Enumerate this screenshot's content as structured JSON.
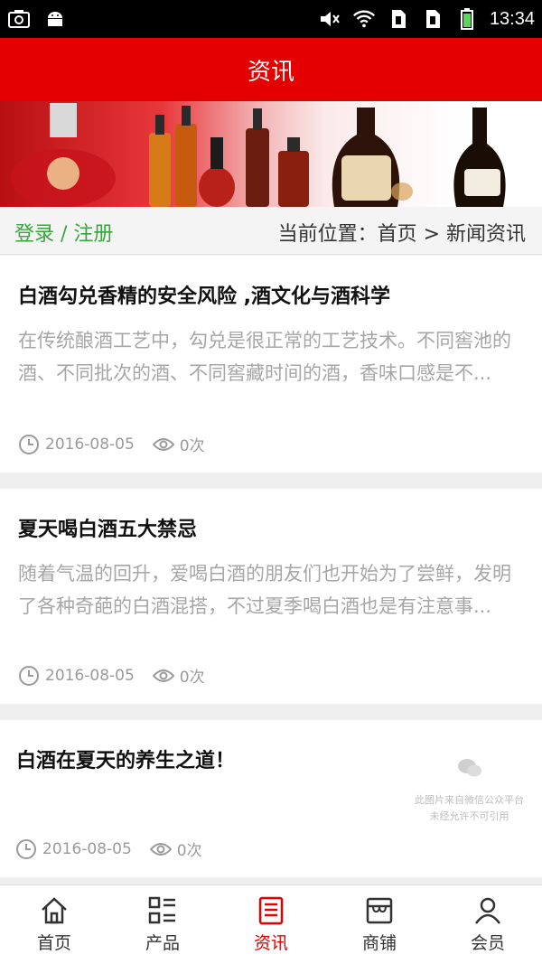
{
  "status_bar": {
    "time": "13:34"
  },
  "header": {
    "title": "资讯"
  },
  "breadcrumb": {
    "login_register": "登录 / 注册",
    "location": "当前位置：首页 > 新闻资讯"
  },
  "articles": [
    {
      "title": "白酒勾兑香精的安全风险 ,酒文化与酒科学",
      "summary": "在传统酿酒工艺中，勾兑是很正常的工艺技术。不同窖池的酒、不同批次的酒、不同窖藏时间的酒，香味口感是不...",
      "date": "2016-08-05",
      "views": "0次"
    },
    {
      "title": "夏天喝白酒五大禁忌",
      "summary": "随着气温的回升，爱喝白酒的朋友们也开始为了尝鲜，发明了各种奇葩的白酒混搭，不过夏季喝白酒也是有注意事...",
      "date": "2016-08-05",
      "views": "0次"
    },
    {
      "title": "白酒在夏天的养生之道！",
      "date": "2016-08-05",
      "views": "0次",
      "watermark_line1": "此图片来自微信公众平台",
      "watermark_line2": "未经允许不可引用"
    }
  ],
  "bottom_nav": [
    {
      "label": "首页",
      "icon": "home-icon"
    },
    {
      "label": "产品",
      "icon": "grid-list-icon"
    },
    {
      "label": "资讯",
      "icon": "news-icon",
      "active": true
    },
    {
      "label": "商铺",
      "icon": "shop-icon"
    },
    {
      "label": "会员",
      "icon": "user-icon"
    }
  ],
  "colors": {
    "brand_red": "#e50000",
    "link_green": "#3aa53e"
  }
}
